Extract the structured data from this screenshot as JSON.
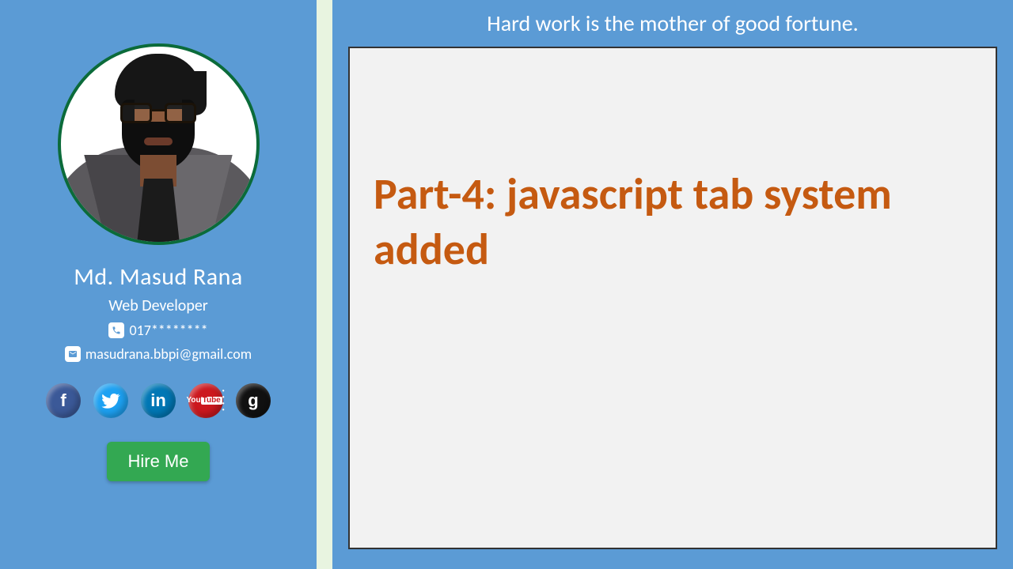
{
  "profile": {
    "name": "Md. Masud Rana",
    "role": "Web Developer",
    "phone": "017********",
    "email": "masudrana.bbpi@gmail.com",
    "hire_label": "Hire Me"
  },
  "social": {
    "facebook": "f",
    "twitter": "",
    "linkedin": "in",
    "youtube_top": "You",
    "youtube_bottom": "Tube",
    "github": "g"
  },
  "header": {
    "tagline": "Hard work is the mother of good fortune."
  },
  "content": {
    "title": "Part-4: javascript tab system added"
  }
}
